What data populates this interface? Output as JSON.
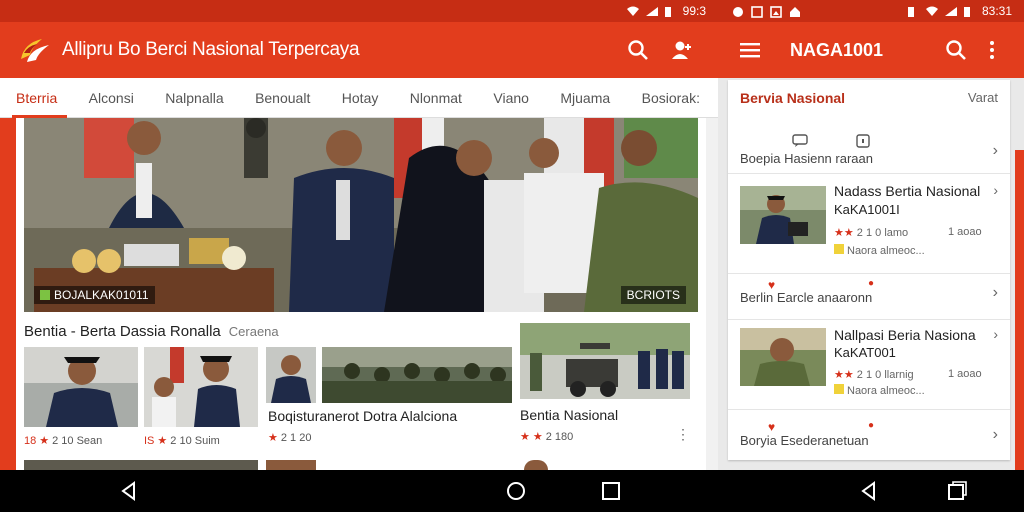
{
  "left": {
    "status": {
      "time": "99:3"
    },
    "app_title": "Allipru Bo Berci Nasional Terpercaya",
    "tabs": [
      "Bterria",
      "Alconsi",
      "Nalpnalla",
      "Benoualt",
      "Hotay",
      "Nlonmat",
      "Viano",
      "Mjuama",
      "Bosiorak:"
    ],
    "hero": {
      "caption": "BOJALKAK01011",
      "tag": "BCRIOTS"
    },
    "section": {
      "title": "Bentia - Berta Dassia Ronalla",
      "subtitle": "Ceraena"
    },
    "news": [
      {
        "title": "",
        "meta": "2 10 Sean",
        "num": "18"
      },
      {
        "title": "",
        "meta": "2 10 Suim",
        "num": "IS"
      },
      {
        "title": "Boqisturanerot Dotra Alalciona",
        "meta": "2 1 20"
      },
      {
        "title": "Bentia Nasional",
        "meta": "2 180"
      }
    ],
    "more_label": "⋮"
  },
  "right": {
    "status": {
      "time": "83:31"
    },
    "app_title": "NAGA1001",
    "header": {
      "title": "Bervia Nasional",
      "action": "Varat"
    },
    "rows": [
      {
        "label": "Boepia Hasienn raraan"
      },
      {
        "title": "Nadass Bertia Nasional",
        "code": "KaKA1001I",
        "meta": "2 1 0 lamo",
        "meta2": "1 aoao",
        "extra": "Naora almeoc..."
      },
      {
        "label": "Berlin Earcle anaaronn"
      },
      {
        "title": "Nallpasi Beria Nasiona",
        "code": "KaKAT001",
        "meta": "2 1 0 llarnig",
        "meta2": "1 aoao",
        "extra": "Naora almeoc..."
      },
      {
        "label": "Boryia Esederanetuan"
      }
    ]
  },
  "colors": {
    "primary": "#e23d1d",
    "status": "#c62d14",
    "accent": "#d6301a"
  }
}
